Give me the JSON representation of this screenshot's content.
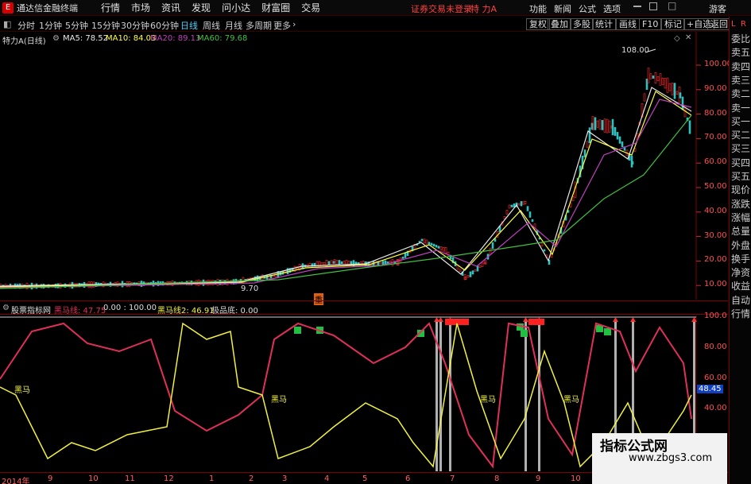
{
  "app": {
    "title": "通达信金融终端",
    "logo": "E"
  },
  "menu": [
    "行情",
    "市场",
    "资讯",
    "发现",
    "问小达",
    "财富圈",
    "交易"
  ],
  "status": {
    "login": "证券交易未登录",
    "stock": "特 力A"
  },
  "right_menu": [
    "功能",
    "新闻",
    "公式",
    "选项"
  ],
  "guest_label": "游客",
  "toolbar": {
    "timeframes": [
      "分时",
      "1分钟",
      "5分钟",
      "15分钟",
      "30分钟",
      "60分钟",
      "日线",
      "周线",
      "月线",
      "多周期",
      "更多"
    ],
    "active": "日线",
    "right_buttons": [
      "复权",
      "叠加",
      "多股",
      "统计",
      "画线",
      "F10",
      "标记",
      "+自选",
      "返回"
    ]
  },
  "main_chart": {
    "name": "特力A(日线)",
    "ma": [
      {
        "label": "MA5: 78.52",
        "color": "#e8e8e8"
      },
      {
        "label": "MA10: 84.03",
        "color": "#ffff40"
      },
      {
        "label": "MA20: 89.13",
        "color": "#c040c0"
      },
      {
        "label": "MA60: 79.68",
        "color": "#40c040"
      }
    ],
    "high_label": "108.00",
    "low_label": "9.70",
    "y_ticks": [
      "100.00",
      "90.00",
      "80.00",
      "70.00",
      "60.00",
      "50.00",
      "40.00",
      "30.00",
      "20.00",
      "10.00"
    ],
    "marker": "重"
  },
  "indicator": {
    "name": "股票指标网",
    "line1": "黑马线: 47.75",
    "vals": "0.00 : 100.00",
    "line2": "黑马线2: 46.91",
    "line3": "极品底: 0.00",
    "y_ticks": [
      "100.0",
      "80.00",
      "60.00",
      "40.00"
    ],
    "current": "48.45",
    "labels": [
      "黑马",
      "黑马",
      "黑马",
      "黑马"
    ]
  },
  "dates": [
    "2014年",
    "9",
    "10",
    "11",
    "12",
    "1",
    "2",
    "3",
    "4",
    "5",
    "6",
    "7",
    "8",
    "9",
    "10"
  ],
  "right_panel": [
    "委比",
    "卖五",
    "卖四",
    "卖三",
    "卖二",
    "卖一",
    "买一",
    "买二",
    "买三",
    "买四",
    "买五",
    "现价",
    "涨跌",
    "涨幅",
    "总量",
    "外盘",
    "换手",
    "净资",
    "收益",
    "自动",
    "行情"
  ],
  "right_panel_top": [
    "L",
    "R"
  ],
  "watermark": {
    "title": "指标公式网",
    "url": "www.zbgs3.com"
  },
  "colors": {
    "up": "#ff3030",
    "down": "#30c0c0",
    "indicator_red": "#e0305a",
    "indicator_yellow": "#f0f040"
  }
}
